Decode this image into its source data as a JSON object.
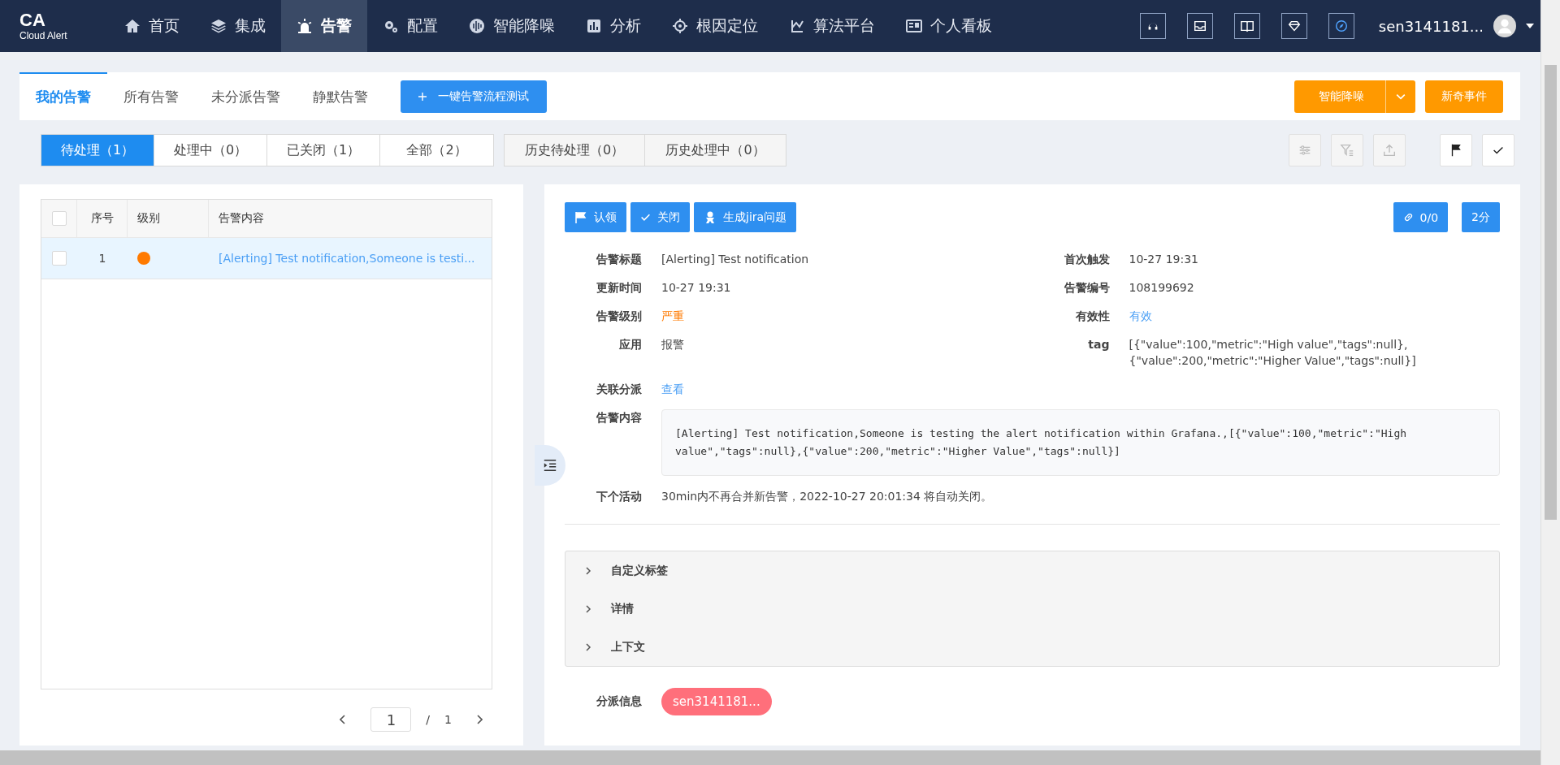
{
  "nav": {
    "logo_title": "CA",
    "logo_subtitle": "Cloud Alert",
    "items": [
      {
        "label": "首页",
        "selected": false
      },
      {
        "label": "集成",
        "selected": false
      },
      {
        "label": "告警",
        "selected": true
      },
      {
        "label": "配置",
        "selected": false
      },
      {
        "label": "智能降噪",
        "selected": false
      },
      {
        "label": "分析",
        "selected": false
      },
      {
        "label": "根因定位",
        "selected": false
      },
      {
        "label": "算法平台",
        "selected": false
      },
      {
        "label": "个人看板",
        "selected": false
      }
    ],
    "user": "sen3141181..."
  },
  "tabs": [
    {
      "label": "我的告警",
      "selected": true
    },
    {
      "label": "所有告警",
      "selected": false
    },
    {
      "label": "未分派告警",
      "selected": false
    },
    {
      "label": "静默告警",
      "selected": false
    }
  ],
  "test_button": "一键告警流程测试",
  "split_button": "智能降噪",
  "event_button": "新奇事件",
  "status_filters": [
    {
      "label": "待处理（1）",
      "selected": true
    },
    {
      "label": "处理中（0）",
      "selected": false
    },
    {
      "label": "已关闭（1）",
      "selected": false
    },
    {
      "label": "全部（2）",
      "selected": false
    }
  ],
  "history_filters": [
    {
      "label": "历史待处理（0）",
      "selected": false
    },
    {
      "label": "历史处理中（0）",
      "selected": false
    }
  ],
  "tool_buttons": [
    {
      "kind": "sliders",
      "disabled": true
    },
    {
      "kind": "filter",
      "disabled": true
    },
    {
      "kind": "upload",
      "disabled": true
    },
    {
      "kind": "flag",
      "disabled": false
    },
    {
      "kind": "check",
      "disabled": false
    }
  ],
  "table": {
    "all_checked": false,
    "columns": [
      "序号",
      "级别",
      "告警内容"
    ],
    "rows": [
      {
        "index": "1",
        "color": "#ff7a00",
        "content": "[Alerting] Test notification,Someone is testi...",
        "selected": true,
        "checked": false
      }
    ]
  },
  "pagination": {
    "page": "1",
    "separator": "/",
    "total": "1"
  },
  "detail": {
    "actions": [
      {
        "label": "认领",
        "kind": "flag"
      },
      {
        "label": "关闭",
        "kind": "check"
      },
      {
        "label": "生成jira问题",
        "kind": "jira"
      }
    ],
    "link_count": "0/0",
    "age": "2分",
    "left_fields": [
      {
        "label": "告警标题",
        "value": "[Alerting] Test notification",
        "kind": "text"
      },
      {
        "label": "更新时间",
        "value": "10-27 19:31",
        "kind": "text"
      },
      {
        "label": "告警级别",
        "value": "严重",
        "kind": "severity"
      },
      {
        "label": "应用",
        "value": "报警",
        "kind": "text"
      }
    ],
    "right_fields": [
      {
        "label": "首次触发",
        "value": "10-27 19:31",
        "kind": "text"
      },
      {
        "label": "告警编号",
        "value": "108199692",
        "kind": "text"
      },
      {
        "label": "有效性",
        "value": "有效",
        "kind": "link"
      },
      {
        "label": "tag",
        "value": "[{\"value\":100,\"metric\":\"High value\",\"tags\":null},\n{\"value\":200,\"metric\":\"Higher Value\",\"tags\":null}]",
        "kind": "text"
      }
    ],
    "related": {
      "label": "关联分派",
      "link": "查看"
    },
    "content": {
      "label": "告警内容",
      "text": "[Alerting] Test notification,Someone is testing the alert notification within Grafana.,[{\"value\":100,\"metric\":\"High value\",\"tags\":null},{\"value\":200,\"metric\":\"Higher Value\",\"tags\":null}]"
    },
    "next": {
      "label": "下个活动",
      "text": "30min内不再合并新告警，2022-10-27 20:01:34 将自动关闭。"
    },
    "sections": [
      {
        "label": "自定义标签",
        "expanded": false
      },
      {
        "label": "详情",
        "expanded": false
      },
      {
        "label": "上下文",
        "expanded": false
      }
    ],
    "assign": {
      "label": "分派信息",
      "chip": "sen3141181..."
    }
  }
}
